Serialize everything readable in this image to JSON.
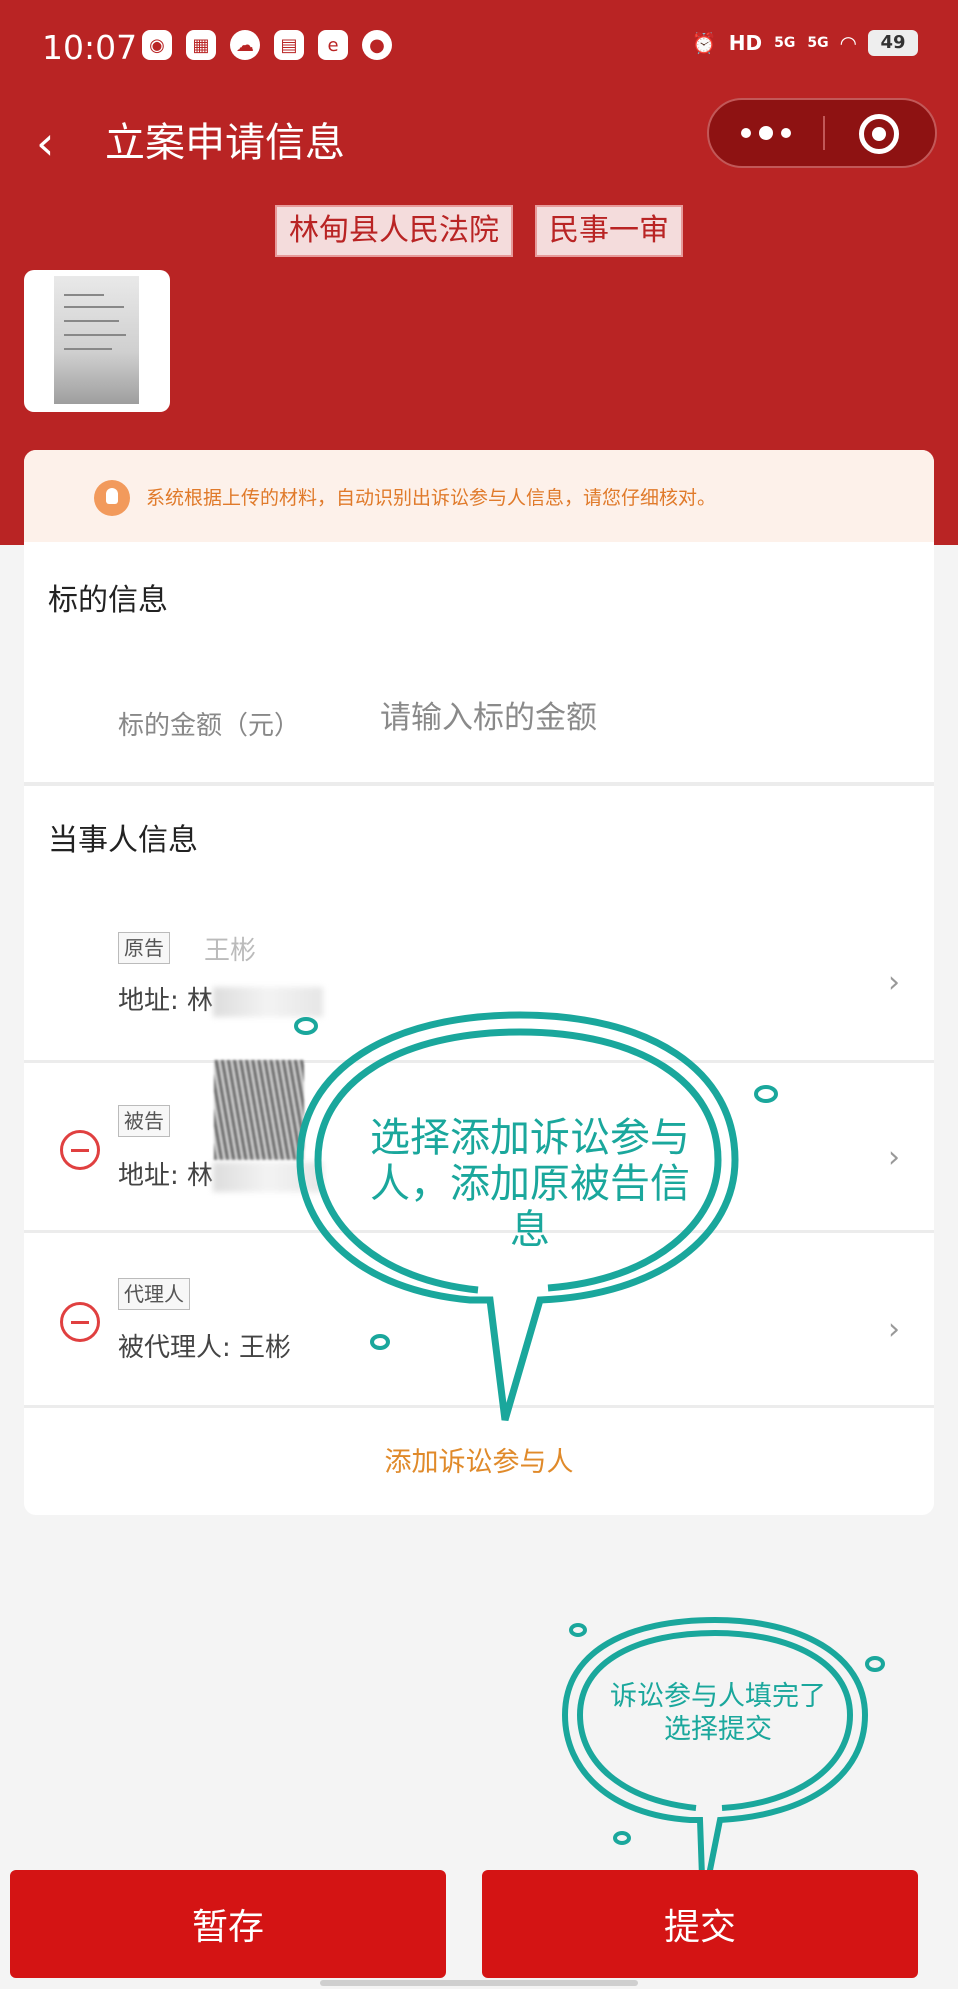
{
  "status_bar": {
    "time": "10:07",
    "network_1": "5G",
    "network_2": "5G",
    "hd_label": "HD",
    "battery": "49",
    "icons": [
      "bird-icon",
      "grid-app-icon",
      "cloud-icon",
      "wallet-icon",
      "e-app-icon",
      "chat-bubble-icon",
      "alarm-icon",
      "wifi-icon"
    ]
  },
  "nav": {
    "title": "立案申请信息",
    "back_icon": "chevron-left-icon",
    "more_icon": "more-dots-icon",
    "close_icon": "target-icon"
  },
  "court_tags": [
    "林甸县人民法院",
    "民事一审"
  ],
  "notice": {
    "icon": "lightbulb-icon",
    "text": "系统根据上传的材料，自动识别出诉讼参与人信息，请您仔细核对。"
  },
  "subject_section": {
    "title": "标的信息",
    "amount_label": "标的金额（元）",
    "amount_placeholder": "请输入标的金额"
  },
  "party_section": {
    "title": "当事人信息",
    "parties": [
      {
        "role": "原告",
        "name": "王彬",
        "detail_prefix": "地址: 林"
      },
      {
        "role": "被告",
        "name": "",
        "detail_prefix": "地址: 林"
      },
      {
        "role": "代理人",
        "name": "",
        "detail_prefix": "被代理人: 王彬"
      }
    ],
    "add_label": "添加诉讼参与人"
  },
  "annotations": {
    "bubble_1": "选择添加诉讼参与人，添加原被告信息",
    "bubble_2": "诉讼参与人填完了选择提交"
  },
  "buttons": {
    "save": "暂存",
    "submit": "提交"
  },
  "colors": {
    "header_red": "#b92424",
    "button_red": "#d41414",
    "annotation_teal": "#1aa79c",
    "link_orange": "#e08a2a"
  }
}
